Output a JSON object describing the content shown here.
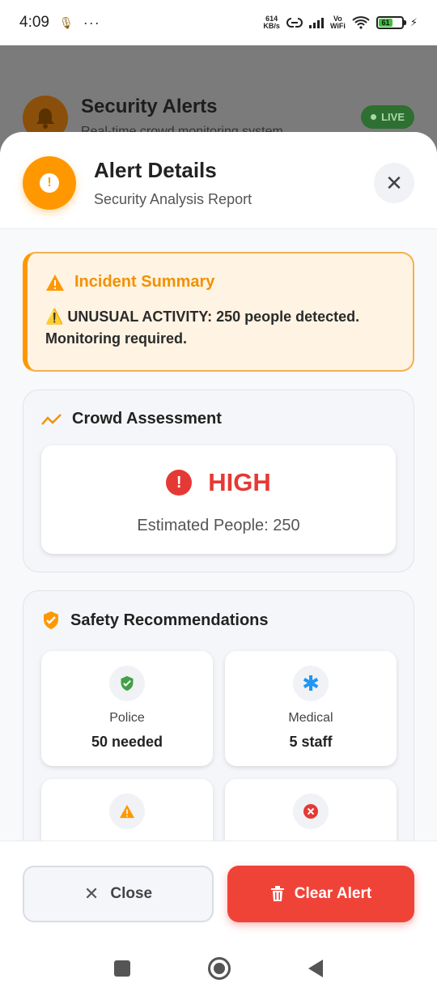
{
  "status_bar": {
    "time": "4:09",
    "speed_value": "614",
    "speed_unit": "KB/s",
    "wifi_label_top": "Vo",
    "wifi_label_bottom": "WiFi",
    "battery": "61"
  },
  "background_app": {
    "title": "Security Alerts",
    "subtitle": "Real-time crowd monitoring system",
    "live_badge": "LIVE"
  },
  "sheet": {
    "title": "Alert Details",
    "subtitle": "Security Analysis Report",
    "incident": {
      "title": "Incident Summary",
      "message": "⚠️ UNUSUAL ACTIVITY: 250 people detected. Monitoring required."
    },
    "crowd": {
      "title": "Crowd Assessment",
      "level": "HIGH",
      "people": "Estimated People: 250"
    },
    "safety": {
      "title": "Safety Recommendations",
      "items": [
        {
          "label": "Police",
          "value": "50 needed",
          "icon": "shield-check-icon"
        },
        {
          "label": "Medical",
          "value": "5 staff",
          "icon": "asterisk-icon"
        },
        {
          "label": "",
          "value": "",
          "icon": "warning-icon"
        },
        {
          "label": "",
          "value": "",
          "icon": "cancel-icon"
        }
      ]
    }
  },
  "footer": {
    "close_label": "Close",
    "clear_label": "Clear Alert"
  },
  "colors": {
    "accent_orange": "#ff9800",
    "danger_red": "#e53935",
    "clear_button": "#f04338"
  }
}
